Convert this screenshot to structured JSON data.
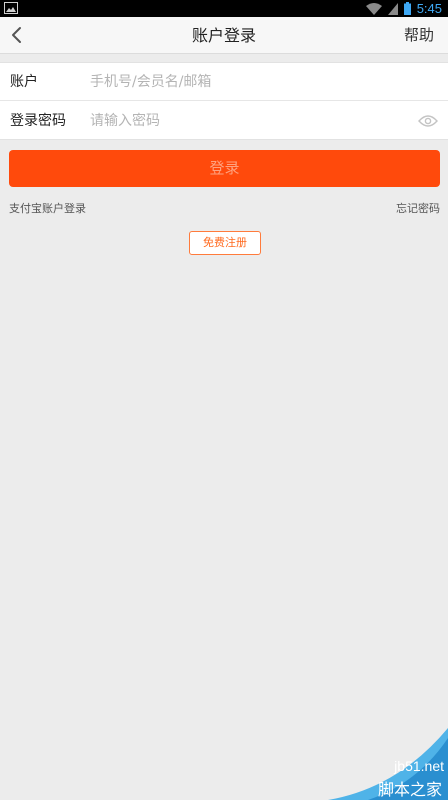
{
  "status_bar": {
    "time": "5:45"
  },
  "nav": {
    "title": "账户登录",
    "help": "帮助",
    "back_icon": "chevron-left-icon"
  },
  "form": {
    "account_label": "账户",
    "account_placeholder": "手机号/会员名/邮箱",
    "password_label": "登录密码",
    "password_placeholder": "请输入密码"
  },
  "actions": {
    "login": "登录",
    "alipay_login": "支付宝账户登录",
    "forgot_password": "忘记密码",
    "register": "免费注册"
  },
  "watermark": {
    "site": "jb51.net",
    "name": "脚本之家"
  },
  "colors": {
    "accent": "#ff4a0c",
    "register": "#ff6a1f",
    "background": "#ececec"
  }
}
